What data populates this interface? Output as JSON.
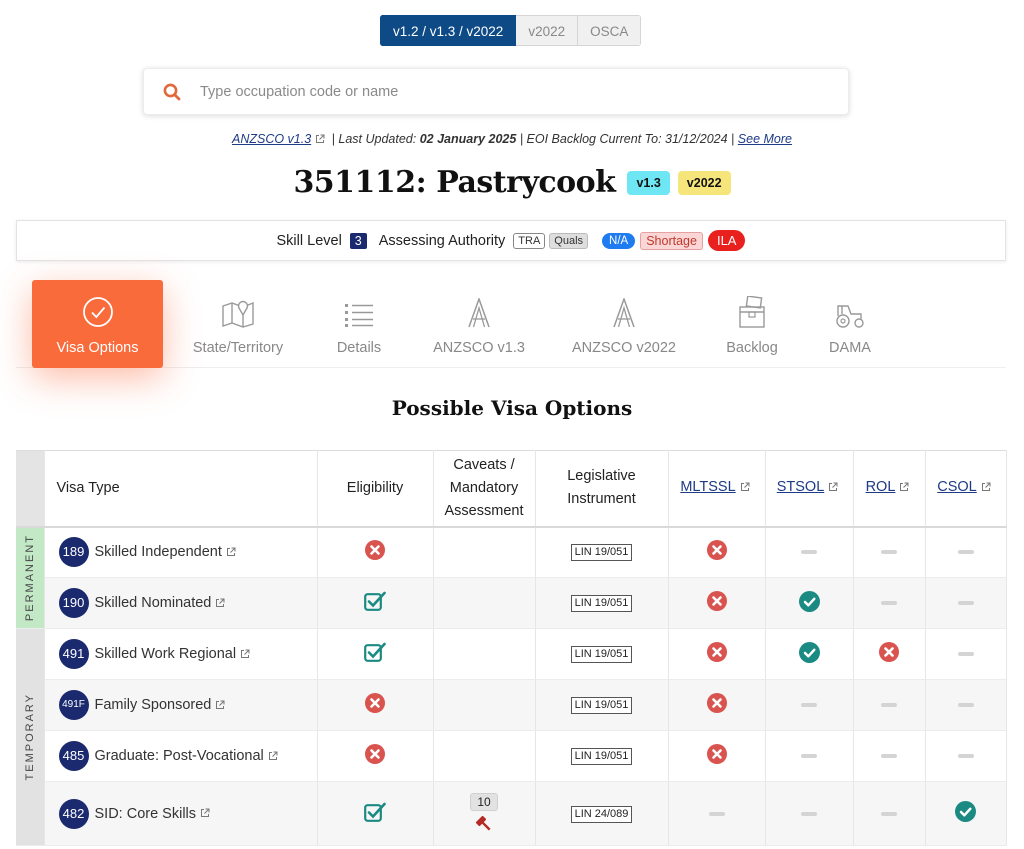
{
  "version_switch": [
    "v1.2 / v1.3 / v2022",
    "v2022",
    "OSCA"
  ],
  "search": {
    "placeholder": "Type occupation code or name"
  },
  "meta": {
    "anzsco_link": "ANZSCO v1.3",
    "last_updated_label": "| Last Updated:",
    "last_updated": "02 January 2025",
    "backlog_text": "| EOI Backlog Current To: 31/12/2024 |",
    "see_more": "See More"
  },
  "occupation": {
    "title": "351112: Pastrycook",
    "badge_v13": "v1.3",
    "badge_v2022": "v2022"
  },
  "info": {
    "skill_level_label": "Skill Level",
    "skill_level": "3",
    "assessing_authority_label": "Assessing Authority",
    "tags": [
      "TRA",
      "Quals"
    ],
    "na": "N/A",
    "shortage": "Shortage",
    "ila": "ILA"
  },
  "tabs": [
    {
      "label": "Visa Options",
      "icon": "check-circle-icon"
    },
    {
      "label": "State/Territory",
      "icon": "map-icon"
    },
    {
      "label": "Details",
      "icon": "list-icon"
    },
    {
      "label": "ANZSCO v1.3",
      "icon": "anzsco-a-icon"
    },
    {
      "label": "ANZSCO v2022",
      "icon": "anzsco-a-icon"
    },
    {
      "label": "Backlog",
      "icon": "boxes-icon"
    },
    {
      "label": "DAMA",
      "icon": "tractor-icon"
    }
  ],
  "section_title": "Possible Visa Options",
  "table": {
    "headers": {
      "visa_type": "Visa Type",
      "eligibility": "Eligibility",
      "caveats_1": "Caveats /",
      "caveats_2": "Mandatory",
      "caveats_3": "Assessment",
      "leg_1": "Legislative",
      "leg_2": "Instrument",
      "mltssl": "MLTSSL",
      "stsol": "STSOL",
      "rol": "ROL",
      "csol": "CSOL"
    },
    "groups": {
      "permanent": "PERMANENT",
      "temporary": "TEMPORARY"
    },
    "rows": [
      {
        "num": "189",
        "name": "Skilled Independent",
        "eligibility": "cross",
        "caveat": "",
        "lin": "LIN 19/051",
        "mltssl": "cross",
        "stsol": "dash",
        "rol": "dash",
        "csol": "dash"
      },
      {
        "num": "190",
        "name": "Skilled Nominated",
        "eligibility": "check",
        "caveat": "",
        "lin": "LIN 19/051",
        "mltssl": "cross",
        "stsol": "tick",
        "rol": "dash",
        "csol": "dash"
      },
      {
        "num": "491",
        "name": "Skilled Work Regional",
        "eligibility": "check",
        "caveat": "",
        "lin": "LIN 19/051",
        "mltssl": "cross",
        "stsol": "tick",
        "rol": "cross",
        "csol": "dash"
      },
      {
        "num": "491F",
        "name": "Family Sponsored",
        "eligibility": "cross",
        "caveat": "",
        "lin": "LIN 19/051",
        "mltssl": "cross",
        "stsol": "dash",
        "rol": "dash",
        "csol": "dash"
      },
      {
        "num": "485",
        "name": "Graduate: Post-Vocational",
        "eligibility": "cross",
        "caveat": "",
        "lin": "LIN 19/051",
        "mltssl": "cross",
        "stsol": "dash",
        "rol": "dash",
        "csol": "dash"
      },
      {
        "num": "482",
        "name": "SID: Core Skills",
        "eligibility": "check",
        "caveat": "10",
        "lin": "LIN 24/089",
        "mltssl": "dash",
        "stsol": "dash",
        "rol": "dash",
        "csol": "tick"
      }
    ]
  },
  "colors": {
    "primary_navy": "#1b2a6e",
    "active_tab": "#f96b3b",
    "cross_red": "#d9534f",
    "check_teal": "#1a8a82"
  }
}
